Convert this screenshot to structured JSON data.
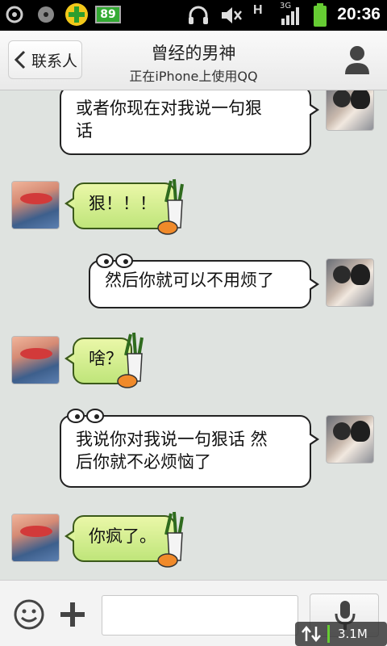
{
  "status_bar": {
    "time": "20:36",
    "battery_app_badge": "89",
    "network_type": "H",
    "signal_label": "3G"
  },
  "header": {
    "back_label": "联系人",
    "title": "曾经的男神",
    "subtitle": "正在iPhone上使用QQ"
  },
  "messages": [
    {
      "from": "me",
      "text_line1": "或者你现在对我说一句狠",
      "text_line2": "话"
    },
    {
      "from": "other",
      "text": "狠！！！"
    },
    {
      "from": "me",
      "text": "然后你就可以不用烦了"
    },
    {
      "from": "other",
      "text": "啥？"
    },
    {
      "from": "me",
      "text_line1": "我说你对我说一句狠话 然",
      "text_line2": "后你就不必烦恼了"
    },
    {
      "from": "other",
      "text": "你疯了。"
    }
  ],
  "input_bar": {
    "input_value": "",
    "network_speed": "3.1M"
  },
  "colors": {
    "chat_background": "#dfe3e0",
    "bubble_other": "#c9eb85",
    "bubble_me": "#ffffff"
  },
  "icons": {
    "back": "chevron-left-icon",
    "profile": "person-icon",
    "emoji": "smiley-icon",
    "plus": "plus-icon",
    "mic": "microphone-icon"
  }
}
